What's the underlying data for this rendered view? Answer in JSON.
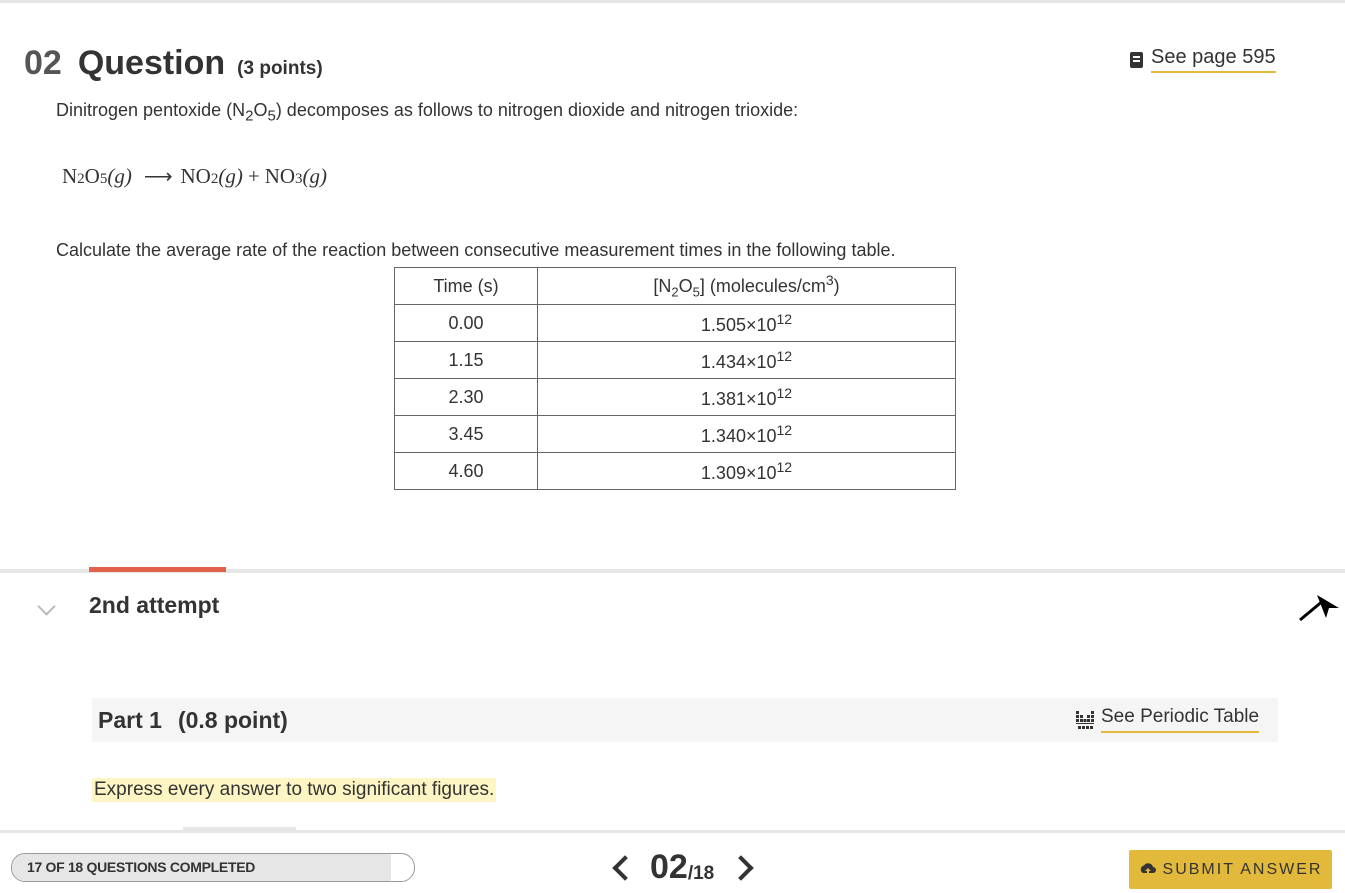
{
  "question": {
    "number": "02",
    "title": "Question",
    "points": "(3 points)",
    "see_page": "See page 595",
    "intro_before": "Dinitrogen pentoxide (N",
    "intro_sub1": "2",
    "intro_mid": "O",
    "intro_sub2": "5",
    "intro_after": ") decomposes as follows to nitrogen dioxide and nitrogen trioxide:",
    "equation": {
      "reactant": "N",
      "r_sub1": "2",
      "r_o": "O",
      "r_sub2": "5",
      "r_state": "(g)",
      "arrow": "⟶",
      "p1": "NO",
      "p1_sub": "2",
      "p1_state": "(g)",
      "plus": "+",
      "p2": "NO",
      "p2_sub": "3",
      "p2_state": "(g)"
    },
    "calc_text": "Calculate the average rate of the reaction between consecutive measurement times in the following table."
  },
  "table": {
    "header_time": "Time (s)",
    "header_conc_a": "[N",
    "header_conc_sub1": "2",
    "header_conc_b": "O",
    "header_conc_sub2": "5",
    "header_conc_c": "] (molecules/cm",
    "header_conc_sup": "3",
    "header_conc_d": ")",
    "rows": [
      {
        "time": "0.00",
        "mantissa": "1.505×10",
        "exp": "12"
      },
      {
        "time": "1.15",
        "mantissa": "1.434×10",
        "exp": "12"
      },
      {
        "time": "2.30",
        "mantissa": "1.381×10",
        "exp": "12"
      },
      {
        "time": "3.45",
        "mantissa": "1.340×10",
        "exp": "12"
      },
      {
        "time": "4.60",
        "mantissa": "1.309×10",
        "exp": "12"
      }
    ]
  },
  "attempt": {
    "label": "2nd attempt"
  },
  "part": {
    "label": "Part 1",
    "points": "(0.8 point)",
    "periodic_link": "See Periodic Table",
    "instruction": "Express every answer to two significant figures."
  },
  "footer": {
    "progress_label": "17 OF 18 QUESTIONS COMPLETED",
    "progress_fraction": 0.944,
    "current": "02",
    "total": "/18",
    "submit_label": "SUBMIT ANSWER"
  },
  "colors": {
    "accent_gold": "#e2b93b",
    "attempt_accent": "#e2614a",
    "highlight": "#fdf6c4"
  },
  "icons": [
    "book-icon",
    "chevron-down-icon",
    "cursor-arrow-icon",
    "periodic-table-icon",
    "chevron-left-icon",
    "chevron-right-icon",
    "cloud-upload-icon"
  ]
}
